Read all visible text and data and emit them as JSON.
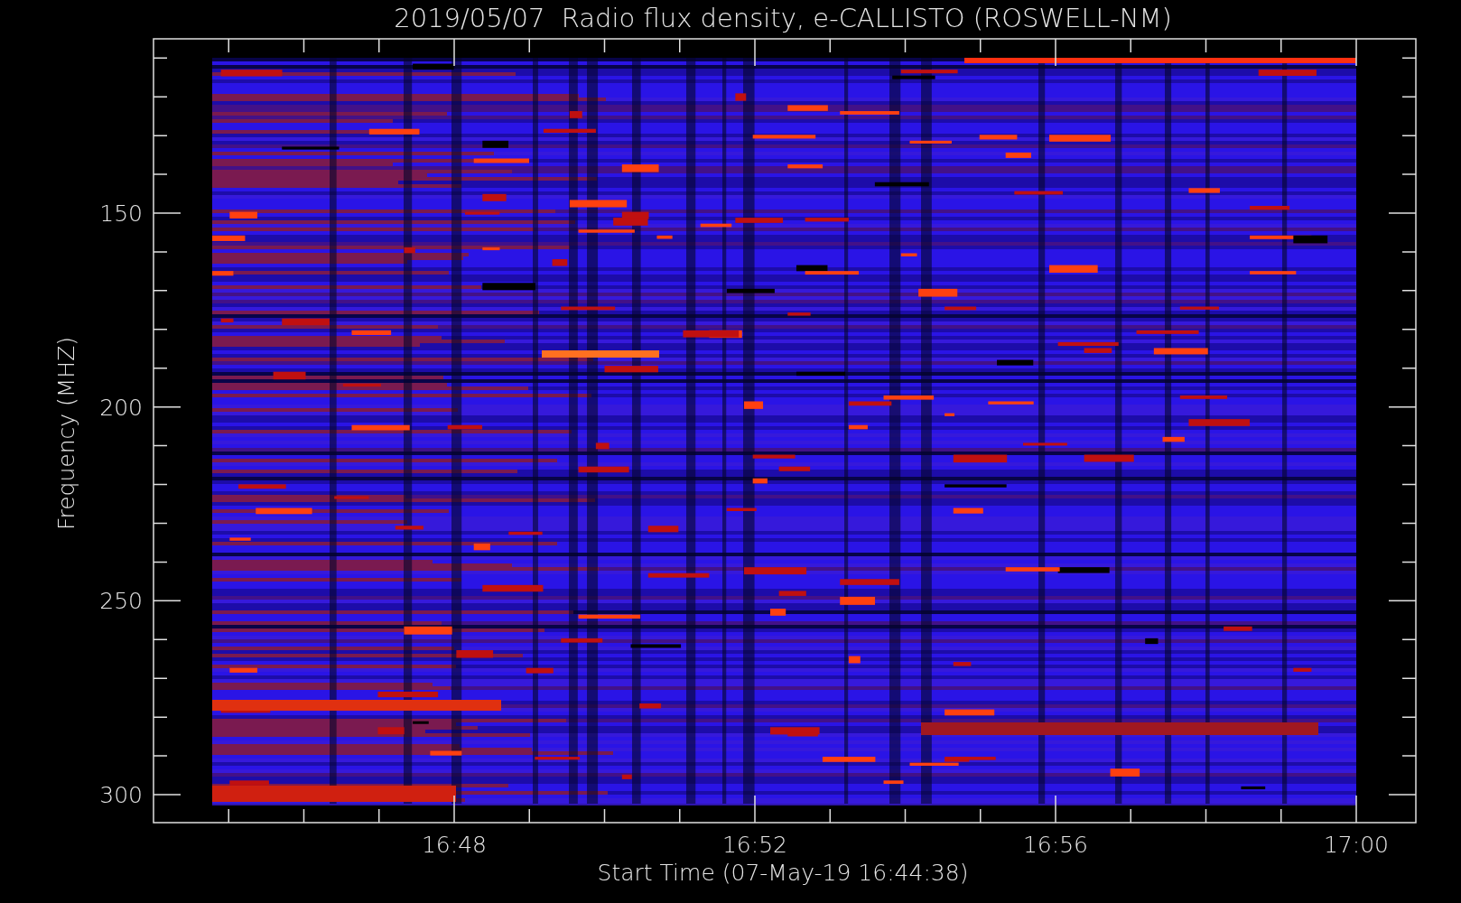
{
  "title": "2019/05/07  Radio flux density, e-CALLISTO (ROSWELL-NM)",
  "y_axis": {
    "label": "Frequency (MHZ)",
    "ticks": [
      "150",
      "200",
      "250",
      "300"
    ]
  },
  "x_axis": {
    "label": "Start Time (07-May-19 16:44:38)",
    "ticks": [
      "16:48",
      "16:52",
      "16:56",
      "17:00"
    ]
  }
}
